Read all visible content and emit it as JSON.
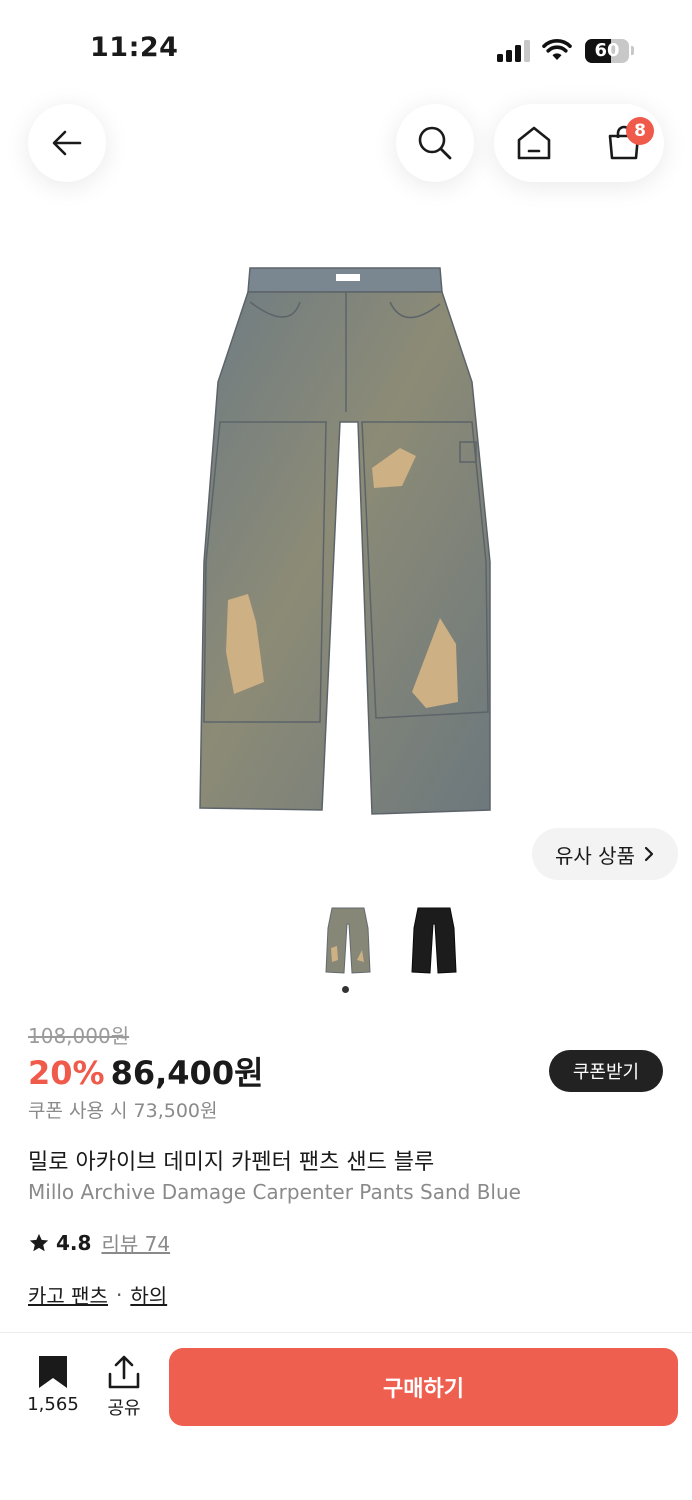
{
  "status_bar": {
    "time": "11:24",
    "battery": "60",
    "battery_level": 0.6
  },
  "header": {
    "back_icon": "arrow-left-icon",
    "search_icon": "search-icon",
    "home_icon": "home-icon",
    "cart_icon": "shopping-bag-icon",
    "cart_count": "8"
  },
  "gallery": {
    "similar_label": "유사 상품",
    "thumbnails": [
      "sand-blue-jeans",
      "black-jeans"
    ],
    "current_page": 1,
    "page_count": 1
  },
  "product": {
    "original_price": "108,000원",
    "discount": "20%",
    "sale_price": "86,400원",
    "coupon_price": "쿠폰 사용 시 73,500원",
    "coupon_button": "쿠폰받기",
    "name_ko": "밀로 아카이브 데미지 카펜터 팬츠 샌드 블루",
    "name_en": "Millo Archive Damage Carpenter Pants Sand Blue",
    "rating": "4.8",
    "review_label": "리뷰 74",
    "categories": [
      "카고 팬츠",
      "하의"
    ],
    "category_separator": "·"
  },
  "bottom_bar": {
    "save_count": "1,565",
    "share_label": "공유",
    "buy_label": "구매하기"
  },
  "colors": {
    "accent": "#ef5f4f",
    "discount": "#ef5a4a",
    "dark": "#222222"
  }
}
